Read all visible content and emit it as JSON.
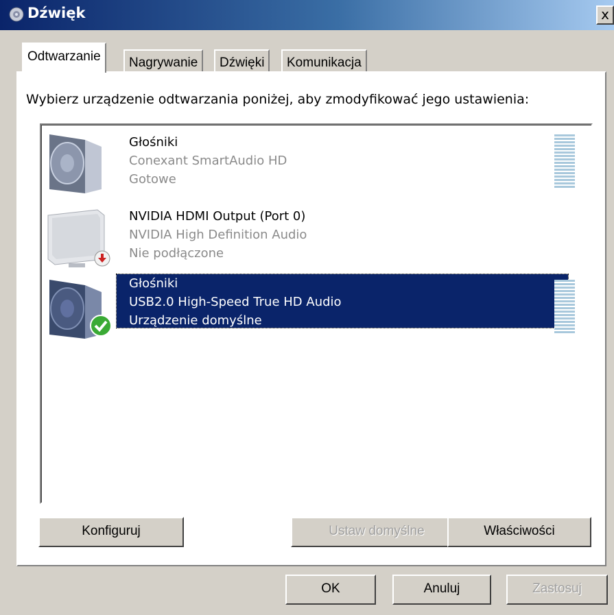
{
  "window": {
    "title": "Dźwięk",
    "close_glyph": "x",
    "icon": "speaker-icon"
  },
  "tabs": [
    {
      "label": "Odtwarzanie",
      "active": true
    },
    {
      "label": "Nagrywanie",
      "active": false
    },
    {
      "label": "Dźwięki",
      "active": false
    },
    {
      "label": "Komunikacja",
      "active": false
    }
  ],
  "instruction": "Wybierz urządzenie odtwarzania poniżej, aby zmodyfikować jego ustawienia:",
  "devices": [
    {
      "name": "Głośniki",
      "driver": "Conexant SmartAudio HD",
      "status": "Gotowe",
      "icon": "speaker-icon",
      "selected": false
    },
    {
      "name": "NVIDIA HDMI Output (Port 0)",
      "driver": "NVIDIA High Definition Audio",
      "status": "Nie podłączone",
      "icon": "monitor-icon",
      "badge": "disconnected-badge-icon",
      "selected": false
    },
    {
      "name": "Głośniki",
      "driver": "USB2.0 High-Speed True HD Audio",
      "status": "Urządzenie domyślne",
      "icon": "speaker-icon",
      "badge": "default-checkmark-icon",
      "selected": true
    }
  ],
  "buttons": {
    "configure": "Konfiguruj",
    "set_default": "Ustaw domyślne",
    "set_default_arrow": "▼",
    "properties": "Właściwości",
    "ok": "OK",
    "cancel": "Anuluj",
    "apply": "Zastosuj"
  },
  "colors": {
    "selection": "#0a246a",
    "titlebar_start": "#0a246a",
    "titlebar_end": "#a6caf0",
    "check_badge": "#3aaa35",
    "disconnect_badge": "#cc2222"
  }
}
